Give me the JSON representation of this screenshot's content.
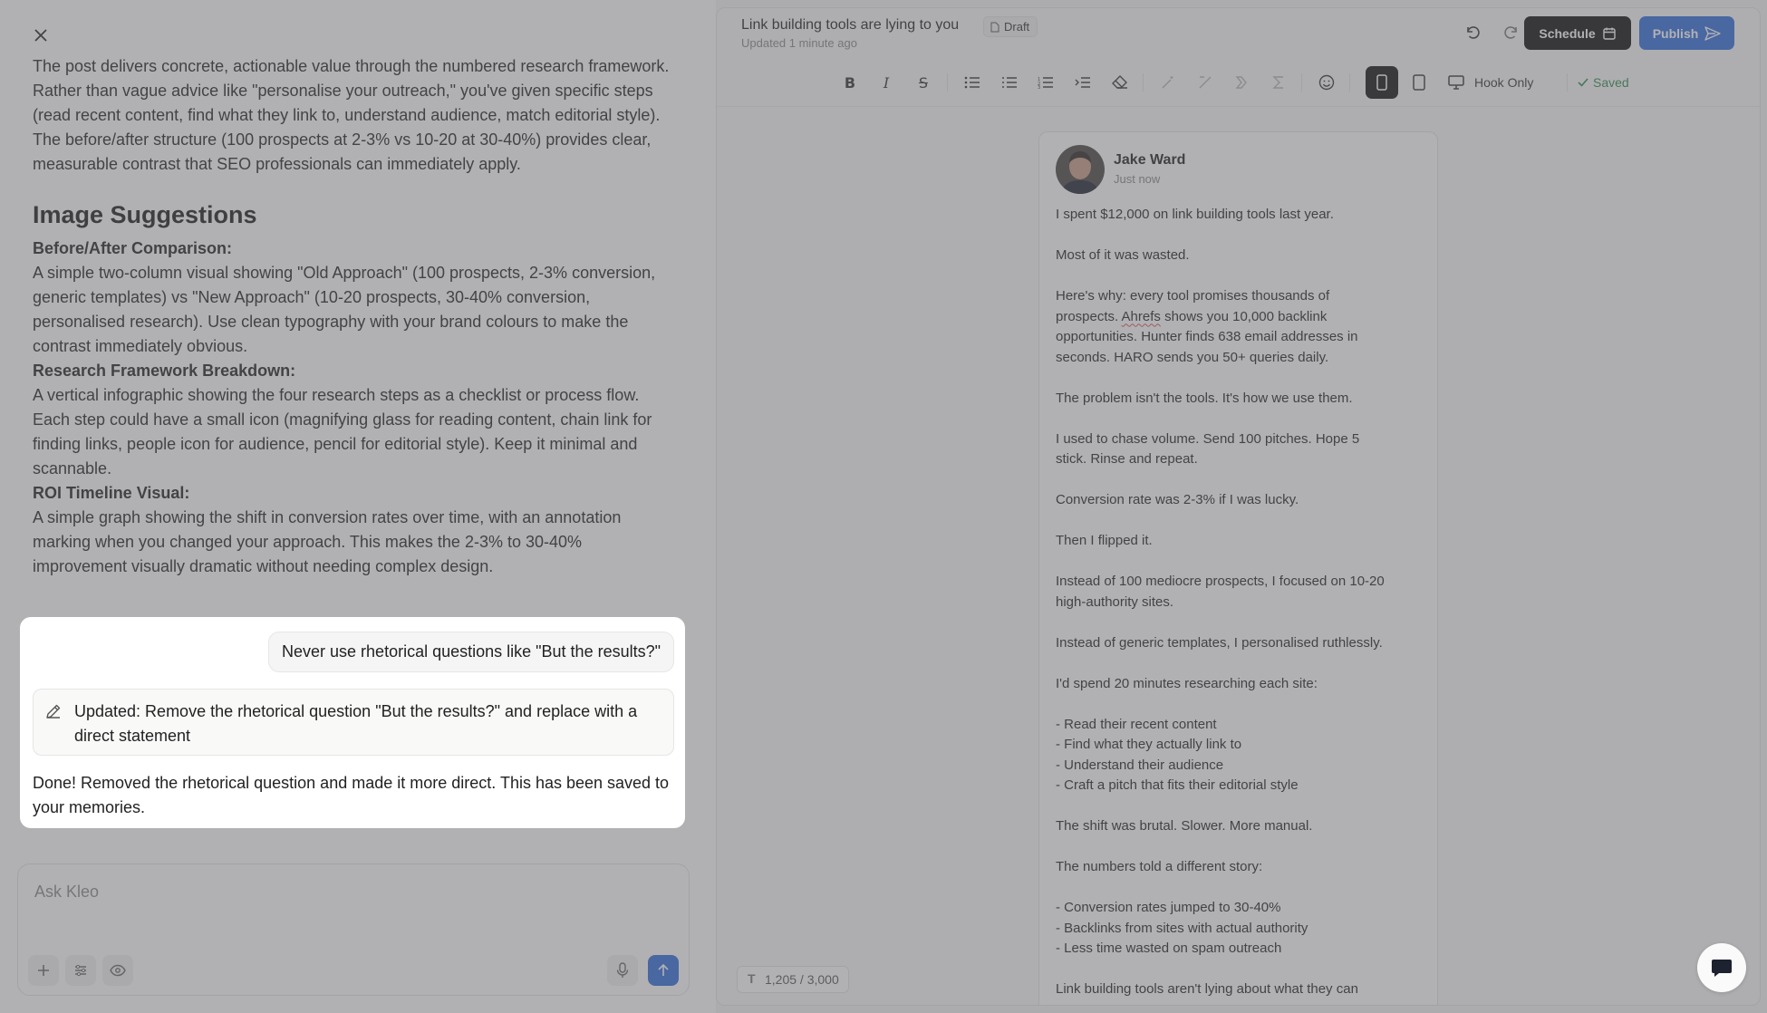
{
  "document": {
    "intro_fragment": "The post delivers concrete, actionable value through the numbered research framework. Rather than vague advice like \"personalise your outreach,\" you've given specific steps (read recent content, find what they link to, understand audience, match editorial style). The before/after structure (100 prospects at 2-3% vs 10-20 at 30-40%) provides clear, measurable contrast that SEO professionals can immediately apply.",
    "heading": "Image Suggestions",
    "sections": [
      {
        "title": "Before/After Comparison:",
        "body": "A simple two-column visual showing \"Old Approach\" (100 prospects, 2-3% conversion, generic templates) vs \"New Approach\" (10-20 prospects, 30-40% conversion, personalised research). Use clean typography with your brand colours to make the contrast immediately obvious."
      },
      {
        "title": "Research Framework Breakdown:",
        "body": "A vertical infographic showing the four research steps as a checklist or process flow. Each step could have a small icon (magnifying glass for reading content, chain link for finding links, people icon for audience, pencil for editorial style). Keep it minimal and scannable."
      },
      {
        "title": "ROI Timeline Visual:",
        "body": "A simple graph showing the shift in conversion rates over time, with an annotation marking when you changed your approach. This makes the 2-3% to 30-40% improvement visually dramatic without needing complex design."
      }
    ]
  },
  "chat": {
    "user_message": "Never use rhetorical questions like \"But the results?\"",
    "update_note": "Updated: Remove the rhetorical question \"But the results?\" and replace with a direct statement",
    "assistant_reply": "Done! Removed the rhetorical question and made it more direct. This has been saved to your memories.",
    "input_placeholder": "Ask Kleo"
  },
  "editor": {
    "title": "Link building tools are lying to you",
    "status_badge": "Draft",
    "updated": "Updated 1 minute ago",
    "schedule_label": "Schedule",
    "publish_label": "Publish",
    "hook_only_label": "Hook Only",
    "saved_label": "Saved",
    "char_count": "1,205 / 3,000"
  },
  "post": {
    "author": "Jake Ward",
    "time": "Just now",
    "lines": [
      "I spent $12,000 on link building tools last year.",
      "",
      "Most of it was wasted.",
      "",
      "Here's why: every tool promises thousands of",
      "prospects. Ahrefs shows you 10,000 backlink",
      "opportunities. Hunter finds 638 email addresses in",
      "seconds. HARO sends you 50+ queries daily.",
      "",
      "The problem isn't the tools. It's how we use them.",
      "",
      "I used to chase volume. Send 100 pitches. Hope 5",
      "stick. Rinse and repeat.",
      "",
      "Conversion rate was 2-3% if I was lucky.",
      "",
      "Then I flipped it.",
      "",
      "Instead of 100 mediocre prospects, I focused on 10-20",
      "high-authority sites.",
      "",
      "Instead of generic templates, I personalised ruthlessly.",
      "",
      "I'd spend 20 minutes researching each site:",
      "",
      "- Read their recent content",
      "- Find what they actually link to",
      "- Understand their audience",
      "- Craft a pitch that fits their editorial style",
      "",
      "The shift was brutal. Slower. More manual.",
      "",
      "The numbers told a different story:",
      "",
      "- Conversion rates jumped to 30-40%",
      "- Backlinks from sites with actual authority",
      "- Less time wasted on spam outreach",
      "",
      "Link building tools aren't lying about what they can"
    ]
  }
}
